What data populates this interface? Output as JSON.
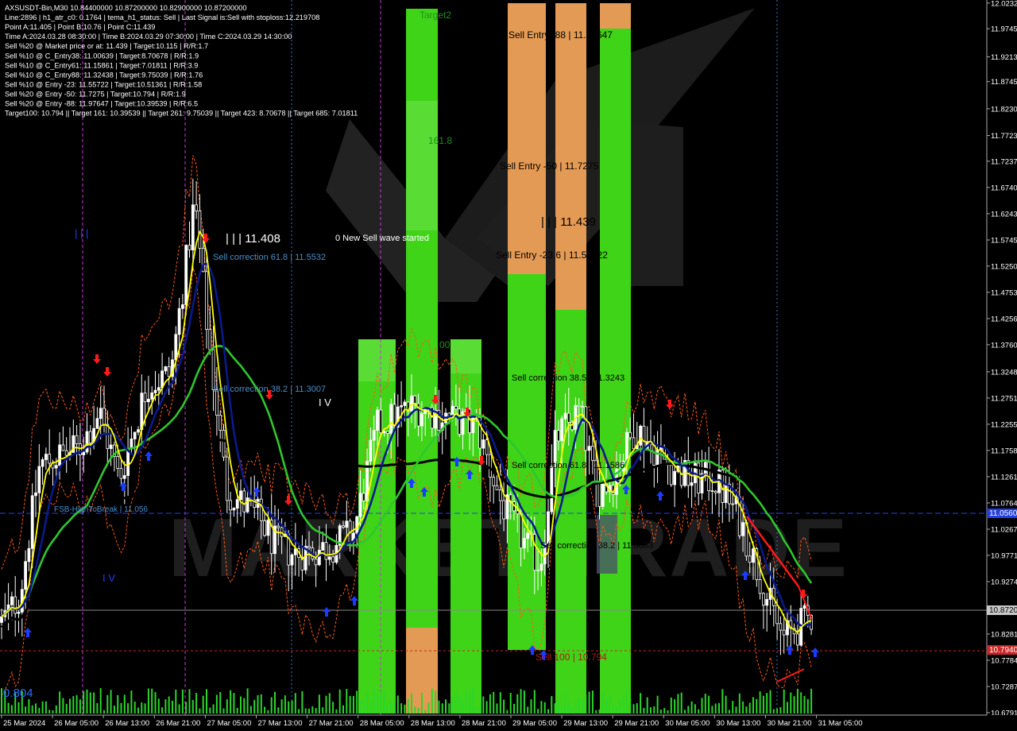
{
  "header": {
    "lines": [
      "AXSUSDT-Bin,M30  10.84400000 10.87200000 10.82900000 10.87200000",
      "Line:2896 | h1_atr_c0: 0.1764 | tema_h1_status: Sell | Last Signal is:Sell with stoploss:12.219708",
      "Point A:11.405 | Point B:10.76 | Point C:11.439",
      "Time A:2024.03.28 08:30:00 | Time B:2024.03.29 07:30:00 | Time C:2024.03.29 14:30:00",
      "Sell %20 @ Market price or at: 11.439 | Target:10.115 | R/R:1.7",
      "Sell %10 @ C_Entry38: 11.00639 | Target:8.70678 | R/R:1.9",
      "Sell %10 @ C_Entry61: 11.15861 | Target:7.01811 | R/R:3.9",
      "Sell %10 @ C_Entry88: 11.32438 | Target:9.75039 | R/R:1.76",
      "Sell %10 @ Entry -23: 11.55722 | Target:10.51361 | R/R:1.58",
      "Sell %20 @ Entry -50: 11.7275 | Target:10.794 | R/R:1.9",
      "Sell %20 @ Entry -88: 11.97647 | Target:10.39539 | R/R:6.5",
      "Target100: 10.794 || Target 161: 10.39539 || Target 261: 9.75039 || Target 423: 8.70678 || Target 685: 7.01811"
    ]
  },
  "annotations": [
    {
      "text": "Target2",
      "color": "#1e8f1e"
    },
    {
      "text": "Sell Entry -88 | 11.97647",
      "color": "#000000"
    },
    {
      "text": "161.8",
      "color": "#1e8f1e"
    },
    {
      "text": "Sell Entry -50 | 11.7275",
      "color": "#000000"
    },
    {
      "text": "| | | 11.439",
      "color": "#000000"
    },
    {
      "text": "| | | 11.408",
      "color": "#ffffff"
    },
    {
      "text": "0 New Sell wave started",
      "color": "#ffffff"
    },
    {
      "text": "Sell correction 61.8 | 11.5532",
      "color": "#4a8ec9"
    },
    {
      "text": "Sell Entry -23.6 | 11.55722",
      "color": "#000000"
    },
    {
      "text": "| | |",
      "color": "#1f3fff"
    },
    {
      "text": "00",
      "color": "#1e8f1e"
    },
    {
      "text": "Sell correction 38.2 | 11.3007",
      "color": "#4a8ec9"
    },
    {
      "text": "I V",
      "color": "#ffffff"
    },
    {
      "text": "Sell correction 38.5 | 11.3243",
      "color": "#000000"
    },
    {
      "text": "Sell correction 61.8 | 11.1586",
      "color": "#000000"
    },
    {
      "text": "FSB-HighToBreak | 11.056",
      "color": "#4a8ec9"
    },
    {
      "text": "I V",
      "color": "#1f3fff"
    },
    {
      "text": "Sell correction 38.2 | 11.0063",
      "color": "#000000"
    },
    {
      "text": "Sell 100 | 10.794",
      "color": "#b01818"
    },
    {
      "text": "0.804",
      "color": "#2b6cff"
    }
  ],
  "watermark": "MARKET TRADE",
  "price_axis": {
    "ticks": [
      "12.0232",
      "11.9745",
      "11.9213",
      "11.8745",
      "11.8230",
      "11.7723",
      "11.7237",
      "11.6740",
      "11.6243",
      "11.5745",
      "11.5250",
      "11.4753",
      "11.4256",
      "11.3760",
      "11.3248",
      "11.2751",
      "11.2255",
      "11.1758",
      "11.1261",
      "11.0764",
      "11.0267",
      "10.9771",
      "10.9274",
      "10.8777",
      "10.8281",
      "10.7784",
      "10.7287",
      "10.6791"
    ],
    "current_price": "10.8720",
    "fsb_price": "11.0560",
    "target_price": "10.7940"
  },
  "time_axis": {
    "labels": [
      "25 Mar 2024",
      "26 Mar 05:00",
      "26 Mar 13:00",
      "26 Mar 21:00",
      "27 Mar 05:00",
      "27 Mar 13:00",
      "27 Mar 21:00",
      "28 Mar 05:00",
      "28 Mar 13:00",
      "28 Mar 21:00",
      "29 Mar 05:00",
      "29 Mar 13:00",
      "29 Mar 21:00",
      "30 Mar 05:00",
      "30 Mar 13:00",
      "30 Mar 21:00",
      "31 Mar 05:00"
    ]
  },
  "colors": {
    "background": "#000000",
    "bull_candle": "#ffffff",
    "bear_candle": "#000000",
    "zone_green": "#3fd417",
    "zone_green_light": "#6fe24a",
    "zone_orange": "#e39a54",
    "ma_yellow": "#ffff00",
    "ma_navy": "#0a1a8c",
    "ma_green": "#2ec72e",
    "ma_black": "#000000",
    "stop_orange": "#ff5a14",
    "fsb_line": "#2a3fe6",
    "current_tag": "#c8c8c8",
    "target_tag": "#c82828",
    "fsb_tag": "#2240e0"
  },
  "chart_data": {
    "type": "candlestick",
    "title": "AXSUSDT-Bin,M30",
    "symbol": "AXSUSDT-Bin",
    "timeframe": "M30",
    "ohlc_last": {
      "open": 10.844,
      "high": 10.872,
      "low": 10.829,
      "close": 10.872
    },
    "ylim": [
      10.679,
      12.023
    ],
    "x_range": [
      "25 Mar 2024",
      "31 Mar 05:00"
    ],
    "grid": false,
    "series": [
      {
        "name": "close",
        "x": [
          "25 Mar 2024",
          "26 Mar 05:00",
          "26 Mar 13:00",
          "26 Mar 21:00",
          "27 Mar 05:00",
          "27 Mar 13:00",
          "27 Mar 21:00",
          "28 Mar 05:00",
          "28 Mar 13:00",
          "28 Mar 21:00",
          "29 Mar 05:00",
          "29 Mar 13:00",
          "29 Mar 21:00",
          "30 Mar 05:00",
          "30 Mar 13:00",
          "30 Mar 21:00",
          "31 Mar 05:00"
        ],
        "values": [
          10.87,
          11.2,
          11.26,
          11.55,
          11.22,
          11.02,
          10.98,
          11.12,
          11.22,
          11.18,
          10.89,
          11.15,
          11.17,
          11.16,
          11.04,
          10.85,
          10.872
        ]
      }
    ],
    "levels": [
      {
        "label": "FSB-HighToBreak",
        "value": 11.056
      },
      {
        "label": "Sell 100",
        "value": 10.794
      },
      {
        "label": "Sell Entry -88",
        "value": 11.97647
      },
      {
        "label": "Sell Entry -50",
        "value": 11.7275
      },
      {
        "label": "Sell Entry -23.6",
        "value": 11.55722
      }
    ]
  }
}
